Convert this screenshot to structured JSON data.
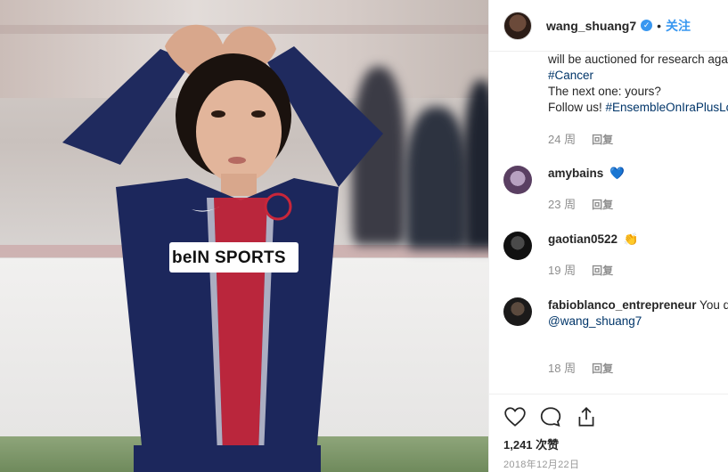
{
  "post": {
    "username": "wang_shuang7",
    "verified_icon": "verified-badge-icon",
    "separator": "•",
    "follow_label": "关注",
    "likes_label": "1,241 次赞",
    "date_label": "2018年12月22日",
    "jersey_text": "beIN SPORTS"
  },
  "caption": {
    "line1": "will be auctioned for research aga",
    "hashtag_cancer": "#Cancer",
    "line3": "The next one: yours?",
    "follow_prefix": "Follow us! ",
    "hashtag_ensemble": "#EnsembleOnIraPlusLoi",
    "time": "24 周",
    "reply": "回复"
  },
  "comments": [
    {
      "username": "amybains",
      "text": "",
      "emoji": "💙",
      "time": "23 周",
      "reply": "回复"
    },
    {
      "username": "gaotian0522",
      "text": "",
      "emoji": "👏",
      "time": "19 周",
      "reply": "回复"
    },
    {
      "username": "fabioblanco_entrepreneur",
      "text": " You deserve the best in this year!!",
      "mention": "@wang_shuang7",
      "time": "18 周",
      "reply": "回复"
    }
  ],
  "actions": {
    "like_icon": "heart-icon",
    "comment_icon": "comment-bubble-icon",
    "share_icon": "share-icon"
  },
  "colors": {
    "link": "#003569",
    "follow": "#3897f0",
    "muted": "#8e8e8e",
    "heart_emoji": "#3aa7e6"
  }
}
